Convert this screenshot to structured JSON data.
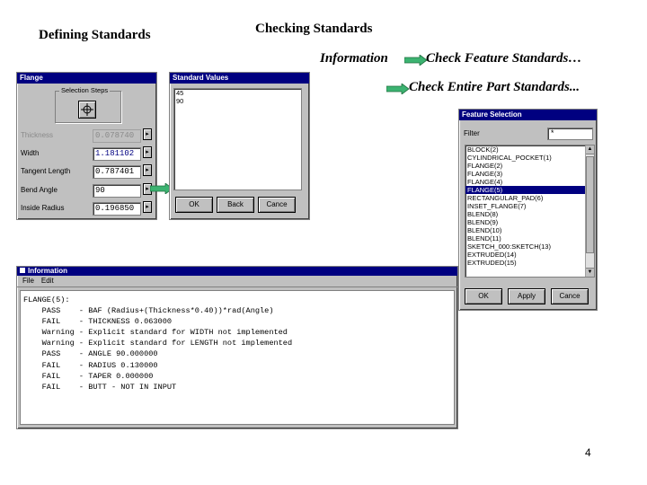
{
  "slide": {
    "title_left": "Defining Standards",
    "title_center": "Checking  Standards",
    "label_information": "Information",
    "label_check_feature": "Check Feature Standards…",
    "label_check_part": "Check Entire Part Standards...",
    "page_number": "4",
    "arrow_color": "#3cb371"
  },
  "flange_window": {
    "title": "Flange",
    "selection_steps_label": "Selection Steps",
    "fields": [
      {
        "label": "Thickness",
        "value": "0.078740",
        "enabled": false
      },
      {
        "label": "Width",
        "value": "1.181102",
        "enabled": true,
        "selected": true
      },
      {
        "label": "Tangent Length",
        "value": "0.787401",
        "enabled": true
      },
      {
        "label": "Bend Angle",
        "value": "90",
        "enabled": true
      },
      {
        "label": "Inside Radius",
        "value": "0.196850",
        "enabled": true
      }
    ]
  },
  "standard_values_window": {
    "title": "Standard Values",
    "values": [
      "45",
      "90"
    ],
    "ok_label": "OK",
    "back_label": "Back",
    "cancel_label": "Cance"
  },
  "feature_selection_window": {
    "title": "Feature Selection",
    "filter_label": "Filter",
    "filter_value": "*",
    "items": [
      "BLOCK(2)",
      "CYLINDRICAL_POCKET(1)",
      "FLANGE(2)",
      "FLANGE(3)",
      "FLANGE(4)",
      "FLANGE(5)",
      "RECTANGULAR_PAD(6)",
      "INSET_FLANGE(7)",
      "BLEND(8)",
      "BLEND(9)",
      "BLEND(10)",
      "BLEND(11)",
      "SKETCH_000:SKETCH(13)",
      "EXTRUDED(14)",
      "EXTRUDED(15)"
    ],
    "selected_index": 5,
    "ok_label": "OK",
    "apply_label": "Apply",
    "cancel_label": "Cance"
  },
  "information_window": {
    "title": "Information",
    "menu": [
      "File",
      "Edit"
    ],
    "lines": [
      "FLANGE(5):",
      "    PASS    - BAF (Radius+(Thickness*0.40))*rad(Angle)",
      "    FAIL    - THICKNESS 0.063000",
      "    Warning - Explicit standard for WIDTH not implemented",
      "    Warning - Explicit standard for LENGTH not implemented",
      "    PASS    - ANGLE 90.000000",
      "    FAIL    - RADIUS 0.130000",
      "    FAIL    - TAPER 0.000000",
      "    FAIL    - BUTT - NOT IN INPUT"
    ]
  }
}
